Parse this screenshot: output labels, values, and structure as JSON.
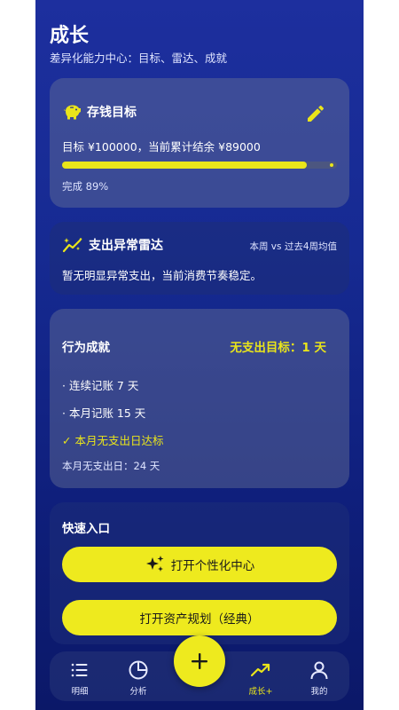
{
  "header": {
    "title": "成长",
    "subtitle": "差异化能力中心：目标、雷达、成就"
  },
  "savings": {
    "title": "存钱目标",
    "description": "目标 ¥100000，当前累计结余 ¥89000",
    "progress_percent": 89,
    "progress_label": "完成 89%"
  },
  "radar": {
    "title": "支出异常雷达",
    "period": "本周 vs 过去4周均值",
    "message": "暂无明显异常支出，当前消费节奏稳定。"
  },
  "achievements": {
    "title": "行为成就",
    "goal": "无支出目标：1 天",
    "items": [
      "· 连续记账 7 天",
      "· 本月记账 15 天",
      "✓ 本月无支出日达标"
    ],
    "no_spend_days": "本月无支出日：24 天"
  },
  "quick": {
    "title": "快速入口",
    "personalize_label": "打开个性化中心",
    "asset_plan_label": "打开资产规划（经典）"
  },
  "nav": {
    "items": [
      {
        "label": "明细",
        "icon": "list-icon"
      },
      {
        "label": "分析",
        "icon": "pie-chart-icon"
      },
      {
        "label": "成长+",
        "icon": "trend-up-icon"
      },
      {
        "label": "我的",
        "icon": "user-icon"
      }
    ],
    "add_icon": "plus-icon"
  },
  "colors": {
    "accent": "#eae51a",
    "background_top": "#1d2f9e",
    "background_bottom": "#0b1868"
  }
}
